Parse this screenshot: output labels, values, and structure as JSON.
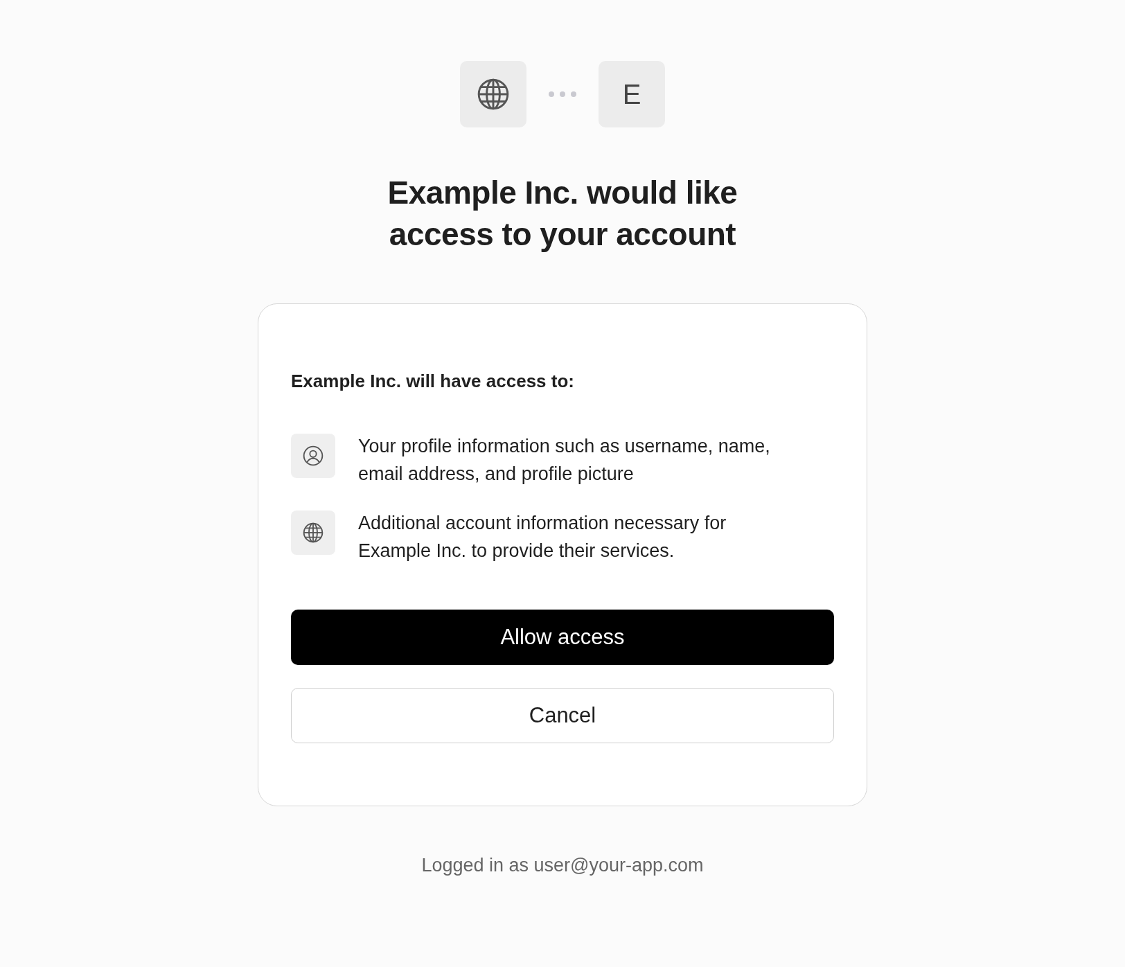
{
  "header": {
    "app_initial": "E",
    "title": "Example Inc. would like access to your account"
  },
  "card": {
    "heading": "Example Inc. will have access to:",
    "permissions": [
      {
        "kind": "profile",
        "text": "Your profile information such as username, name, email address, and profile picture"
      },
      {
        "kind": "globe",
        "text": "Additional account information necessary for Example Inc. to provide their services."
      }
    ],
    "buttons": [
      {
        "kind": "primary",
        "label": "Allow access"
      },
      {
        "kind": "secondary",
        "label": "Cancel"
      }
    ]
  },
  "footer": "Logged in as user@your-app.com"
}
